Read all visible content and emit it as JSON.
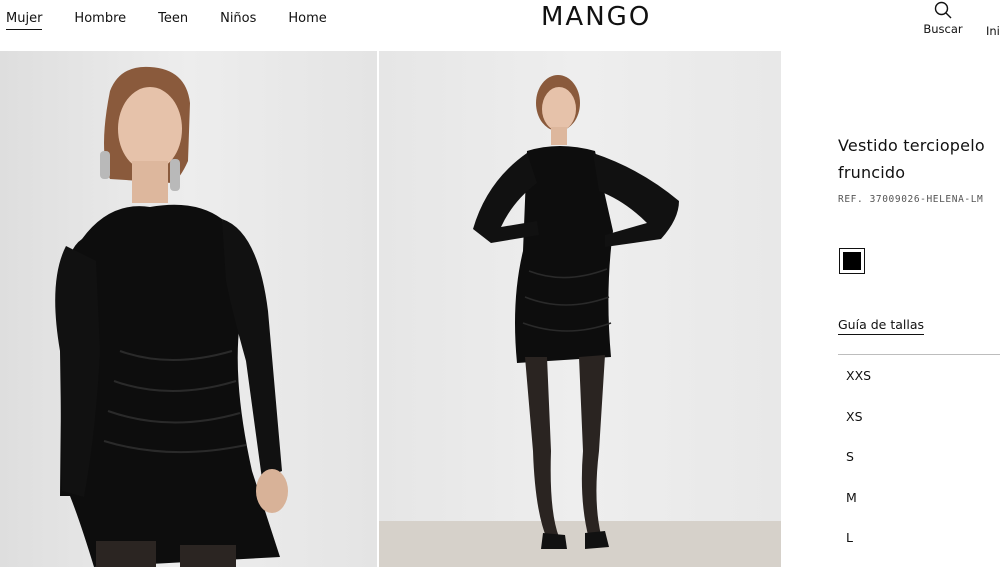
{
  "header": {
    "nav": [
      {
        "label": "Mujer",
        "active": true
      },
      {
        "label": "Hombre",
        "active": false
      },
      {
        "label": "Teen",
        "active": false
      },
      {
        "label": "Niños",
        "active": false
      },
      {
        "label": "Home",
        "active": false
      }
    ],
    "logo": "MANGO",
    "search_label": "Buscar",
    "search_icon": "search-icon",
    "account_label": "Ini"
  },
  "product": {
    "title": "Vestido terciopelo fruncido",
    "ref": "REF. 37009026-HELENA-LM",
    "colors": [
      {
        "name": "black",
        "hex": "#000000",
        "selected": true
      }
    ],
    "size_guide_label": "Guía de tallas",
    "sizes": [
      "XXS",
      "XS",
      "S",
      "M",
      "L"
    ]
  },
  "colors": {
    "text": "#111111",
    "photo_background": "#e8e8e8",
    "dress": "#0d0d0d",
    "divider": "#bdbdbd"
  }
}
